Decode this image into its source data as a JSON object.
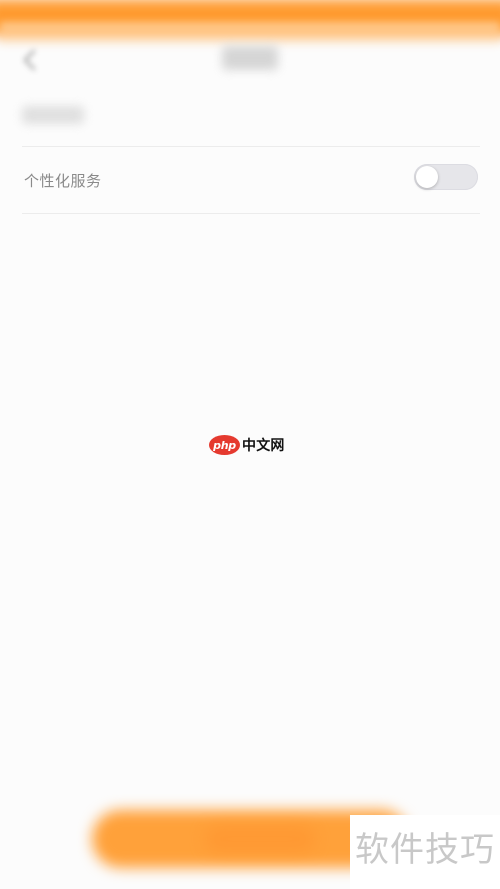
{
  "header": {
    "back_icon": "chevron-left-icon"
  },
  "settings": {
    "personalized_service": {
      "label": "个性化服务",
      "enabled": false
    }
  },
  "watermark": {
    "php_text": "php",
    "site_name": "中文网"
  },
  "corner_badge": {
    "text": "软件技巧"
  },
  "colors": {
    "accent_orange": "#ff9a2e",
    "toggle_off": "#e6e6ea",
    "php_red": "#e53a2f"
  }
}
